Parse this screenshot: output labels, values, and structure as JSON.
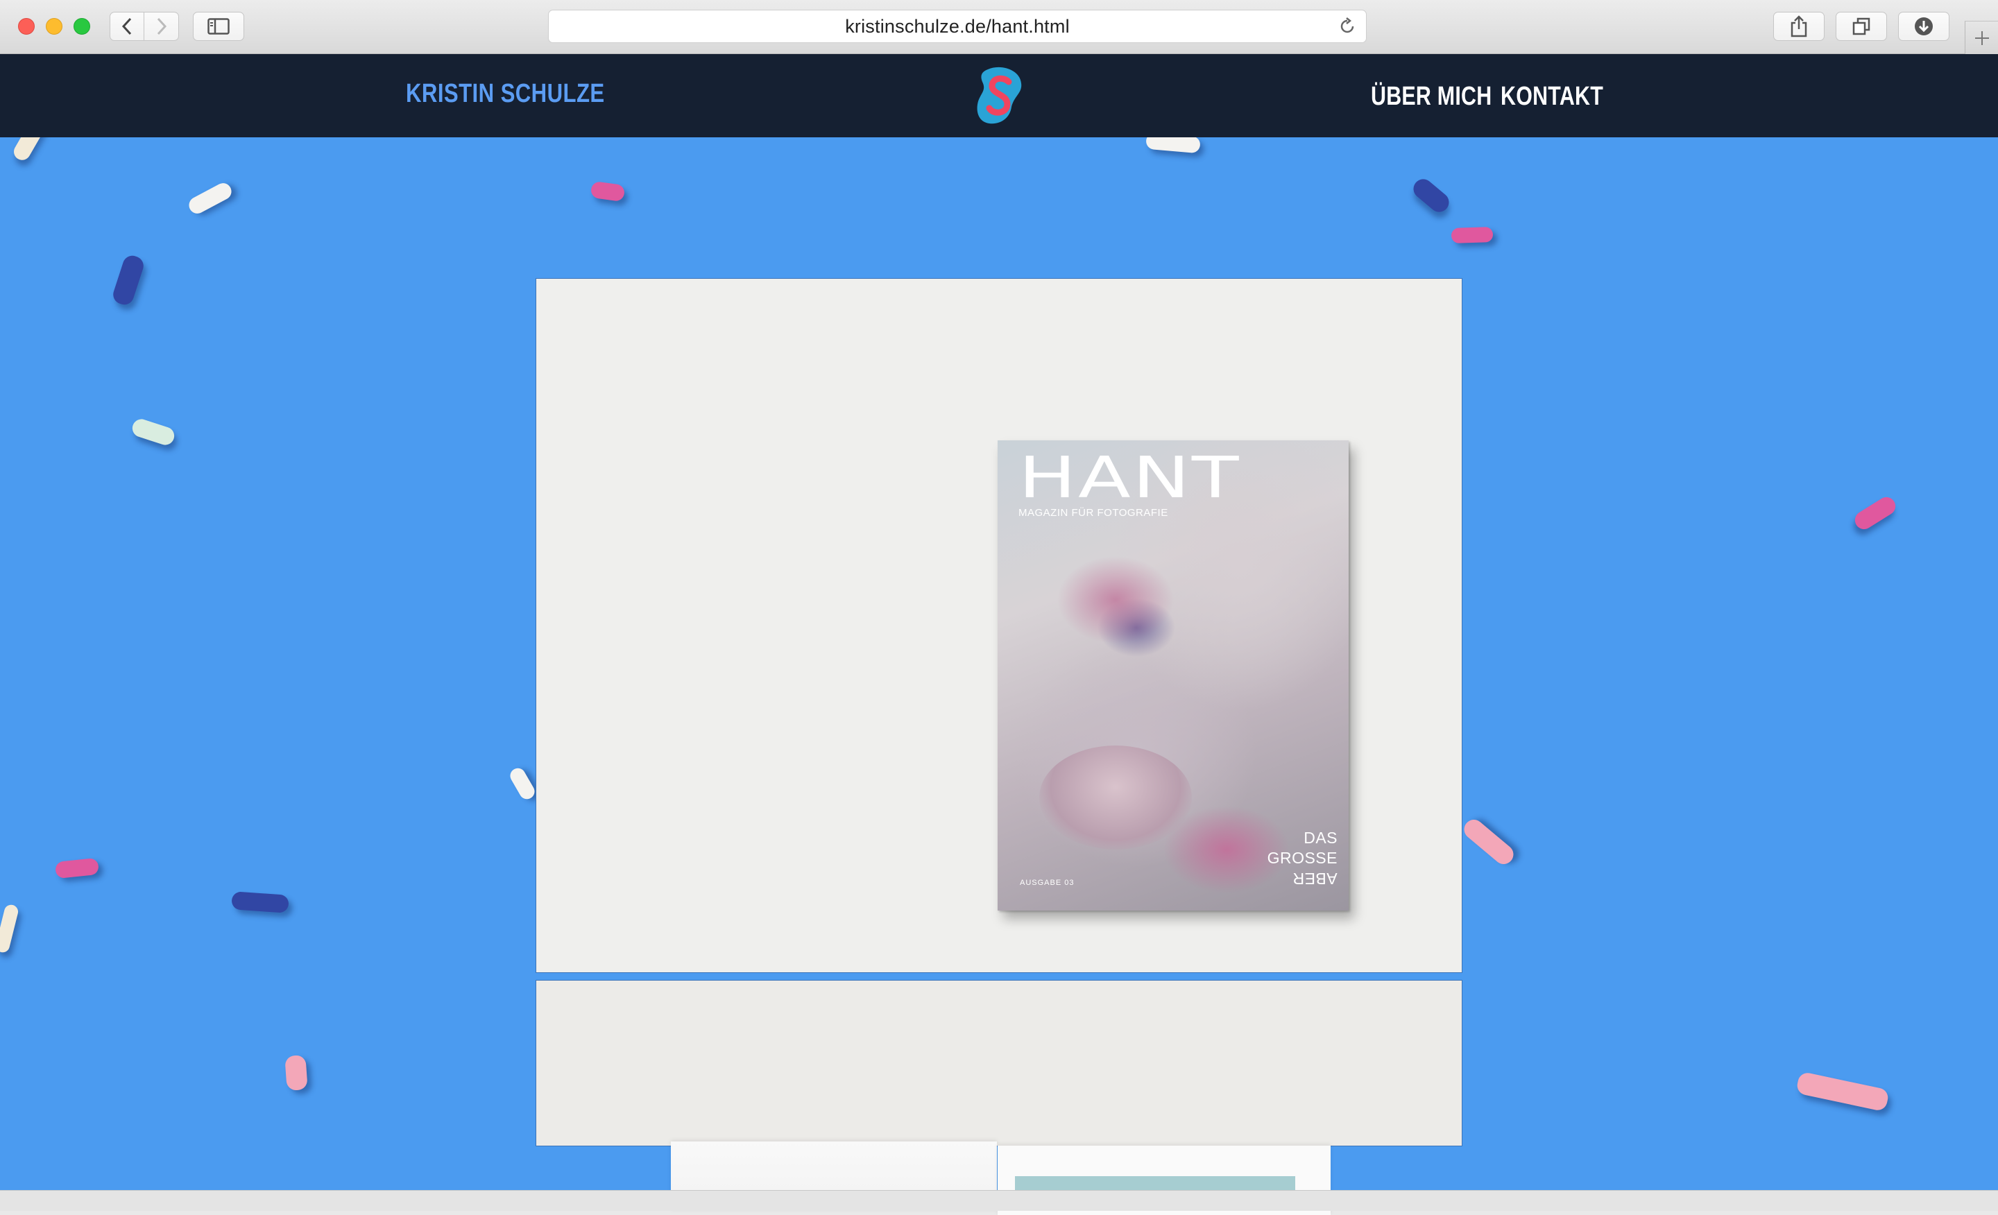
{
  "browser": {
    "url": "kristinschulze.de/hant.html",
    "buttons": {
      "back": "chevron-left-icon",
      "forward": "chevron-right-icon",
      "sidebar": "sidebar-icon",
      "reload": "reload-icon",
      "share": "share-icon",
      "tabs": "tabs-icon",
      "download": "download-icon",
      "new_tab": "plus-icon"
    }
  },
  "site": {
    "brand": "KRISTIN SCHULZE",
    "logo_icon": "s-logo-icon",
    "nav": [
      {
        "label": "ÜBER MICH"
      },
      {
        "label": "KONTAKT"
      }
    ]
  },
  "magazine": {
    "title": "HANT",
    "subtitle": "MAGAZIN FÜR FOTOGRAFIE",
    "cover_lines": [
      "DAS",
      "GROSSE",
      "ABER"
    ],
    "issue": "AUSGABE 03"
  },
  "colors": {
    "header_bg": "#152032",
    "brand": "#5b9cf2",
    "background": "#4b9bf0"
  }
}
